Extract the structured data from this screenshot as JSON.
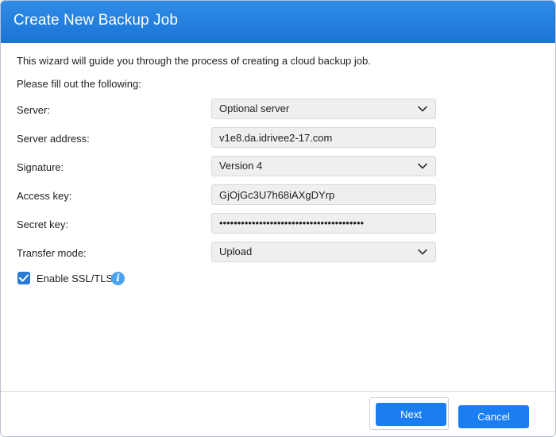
{
  "dialog": {
    "title": "Create New Backup Job",
    "intro": "This wizard will guide you through the process of creating a cloud backup job.",
    "subintro": "Please fill out the following:"
  },
  "form": {
    "server": {
      "label": "Server:",
      "value": "Optional server"
    },
    "server_address": {
      "label": "Server address:",
      "value": "v1e8.da.idrivee2-17.com"
    },
    "signature": {
      "label": "Signature:",
      "value": "Version 4"
    },
    "access_key": {
      "label": "Access key:",
      "value": "GjOjGc3U7h68iAXgDYrp"
    },
    "secret_key": {
      "label": "Secret key:",
      "value": "••••••••••••••••••••••••••••••••••••••••"
    },
    "transfer_mode": {
      "label": "Transfer mode:",
      "value": "Upload"
    },
    "ssl": {
      "label": "Enable SSL/TLS",
      "checked": true
    }
  },
  "footer": {
    "next_label": "Next",
    "cancel_label": "Cancel"
  },
  "colors": {
    "title_bar": "#1c74d6",
    "primary_button": "#1a7ef2",
    "checkbox": "#2a7ad6",
    "info_icon": "#4aa3ec"
  },
  "icons": {
    "dropdown": "chevron-down-icon",
    "info": "info-icon",
    "check": "check-icon"
  }
}
